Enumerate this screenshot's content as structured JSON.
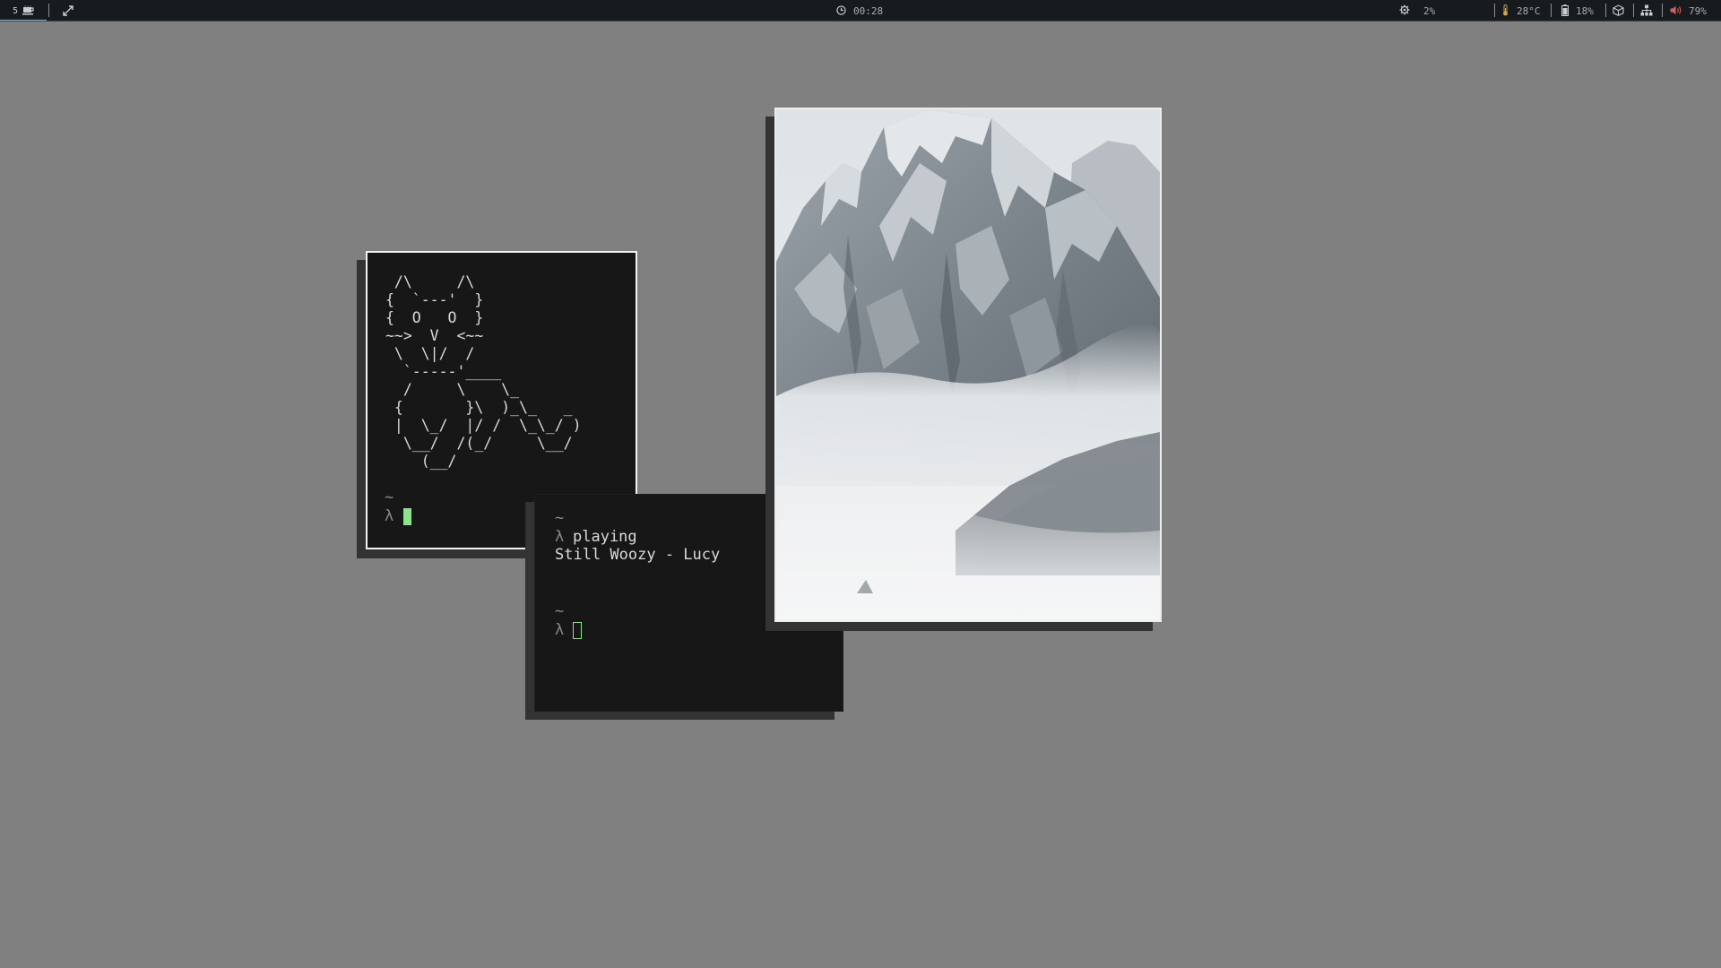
{
  "topbar": {
    "workspace_number": "5",
    "workspace_icon": "coffee-icon",
    "fullscreen_icon": "expand-arrows-icon",
    "clock_icon": "clock-icon",
    "clock": "00:28",
    "cpu_icon": "gear-icon",
    "cpu": "2%",
    "temp_icon": "thermometer-icon",
    "temperature": "28°C",
    "battery_icon": "battery-icon",
    "battery": "18%",
    "package_icon": "cube-icon",
    "network_icon": "network-icon",
    "volume_icon": "speaker-icon",
    "volume": "79%",
    "colors": {
      "bar_bg": "#171b1e",
      "indicator": "#8fb3c8",
      "temp_accent": "#d2a34a",
      "volume_accent": "#d65f5f"
    }
  },
  "terminal_left": {
    "ascii_art": " /\\     /\\\n{  `---'  }\n{  O   O  }\n~~>  V  <~~\n \\  \\|/  /\n  `-----'____\n  /     \\    \\_\n {       }\\  )_\\_   _\n |  \\_/  |/ /  \\_\\_/ )\n  \\__/  /(_/     \\__/\n    (__/",
    "tilde": "~",
    "prompt": "λ"
  },
  "terminal_right": {
    "tilde_1": "~",
    "prompt_1": "λ",
    "command": "playing",
    "output": "Still Woozy - Lucy",
    "tilde_2": "~",
    "prompt_2": "λ"
  },
  "image_window": {
    "subject": "snowy-mountain-with-fog"
  },
  "colors": {
    "desktop_bg": "#808080",
    "terminal_bg": "#171717",
    "cursor": "#8fe08f"
  }
}
